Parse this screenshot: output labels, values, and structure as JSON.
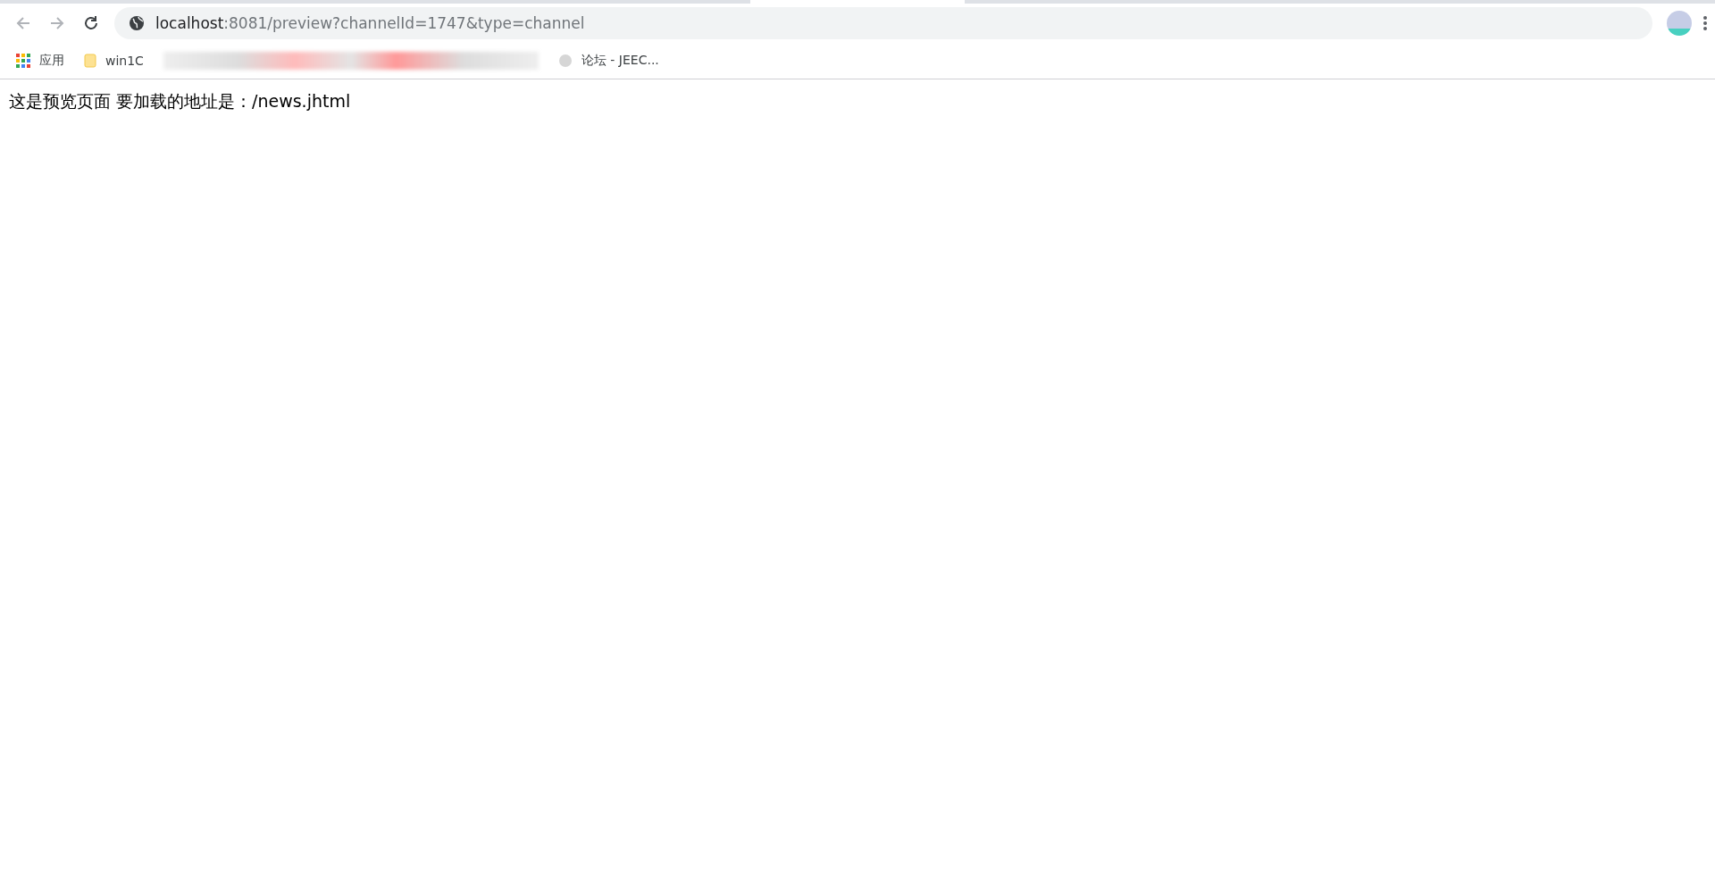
{
  "toolbar": {
    "url_host": "localhost",
    "url_rest": ":8081/preview?channelId=1747&type=channel"
  },
  "bookmarks": [
    {
      "kind": "apps",
      "label": "应用"
    },
    {
      "kind": "folder",
      "label": "win1C"
    },
    {
      "kind": "redacted"
    },
    {
      "kind": "site",
      "label": "论坛 - JEEC..."
    }
  ],
  "page": {
    "text": "这是预览页面 要加载的地址是：/news.jhtml"
  }
}
